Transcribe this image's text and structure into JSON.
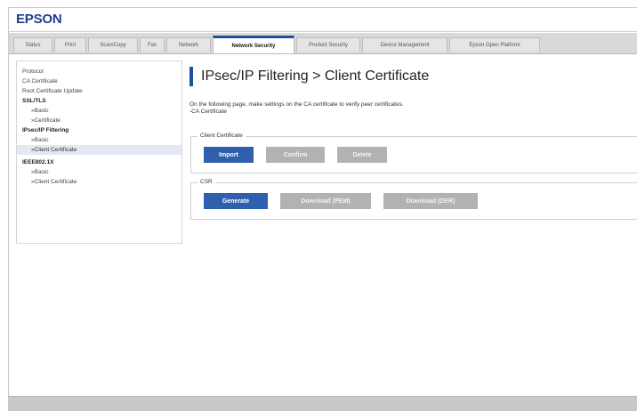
{
  "brand": {
    "logo": "EPSON"
  },
  "tabs": [
    {
      "label": "Status",
      "active": false
    },
    {
      "label": "Print",
      "active": false
    },
    {
      "label": "Scan/Copy",
      "active": false
    },
    {
      "label": "Fax",
      "active": false
    },
    {
      "label": "Network",
      "active": false
    },
    {
      "label": "Network Security",
      "active": true
    },
    {
      "label": "Product Security",
      "active": false
    },
    {
      "label": "Device Management",
      "active": false
    },
    {
      "label": "Epson Open Platform",
      "active": false
    }
  ],
  "sidebar": {
    "items": [
      {
        "label": "Protocol"
      },
      {
        "label": "CA Certificate"
      },
      {
        "label": "Root Certificate Update"
      },
      {
        "label": "SSL/TLS"
      },
      {
        "label": "»Basic"
      },
      {
        "label": "»Certificate"
      },
      {
        "label": "IPsec/IP Filtering"
      },
      {
        "label": "»Basic"
      },
      {
        "label": "»Client Certificate"
      },
      {
        "label": "IEEE802.1X"
      },
      {
        "label": "»Basic"
      },
      {
        "label": "»Client Certificate"
      }
    ]
  },
  "main": {
    "title": "IPsec/IP Filtering > Client Certificate",
    "description_line1": "On the following page, make settings on the CA certificate to verify peer certificates.",
    "description_line2": "-CA Certificate",
    "client_certificate": {
      "legend": "Client Certificate",
      "import_label": "Import",
      "confirm_label": "Confirm",
      "delete_label": "Delete"
    },
    "csr": {
      "legend": "CSR",
      "generate_label": "Generate",
      "download_pem_label": "Download (PEM)",
      "download_der_label": "Download (DER)"
    }
  },
  "colors": {
    "accent": "#1f4f9e",
    "primary_button": "#2f5fad",
    "disabled_button": "#b2b2b2",
    "tab_bar": "#d9d9d9"
  }
}
